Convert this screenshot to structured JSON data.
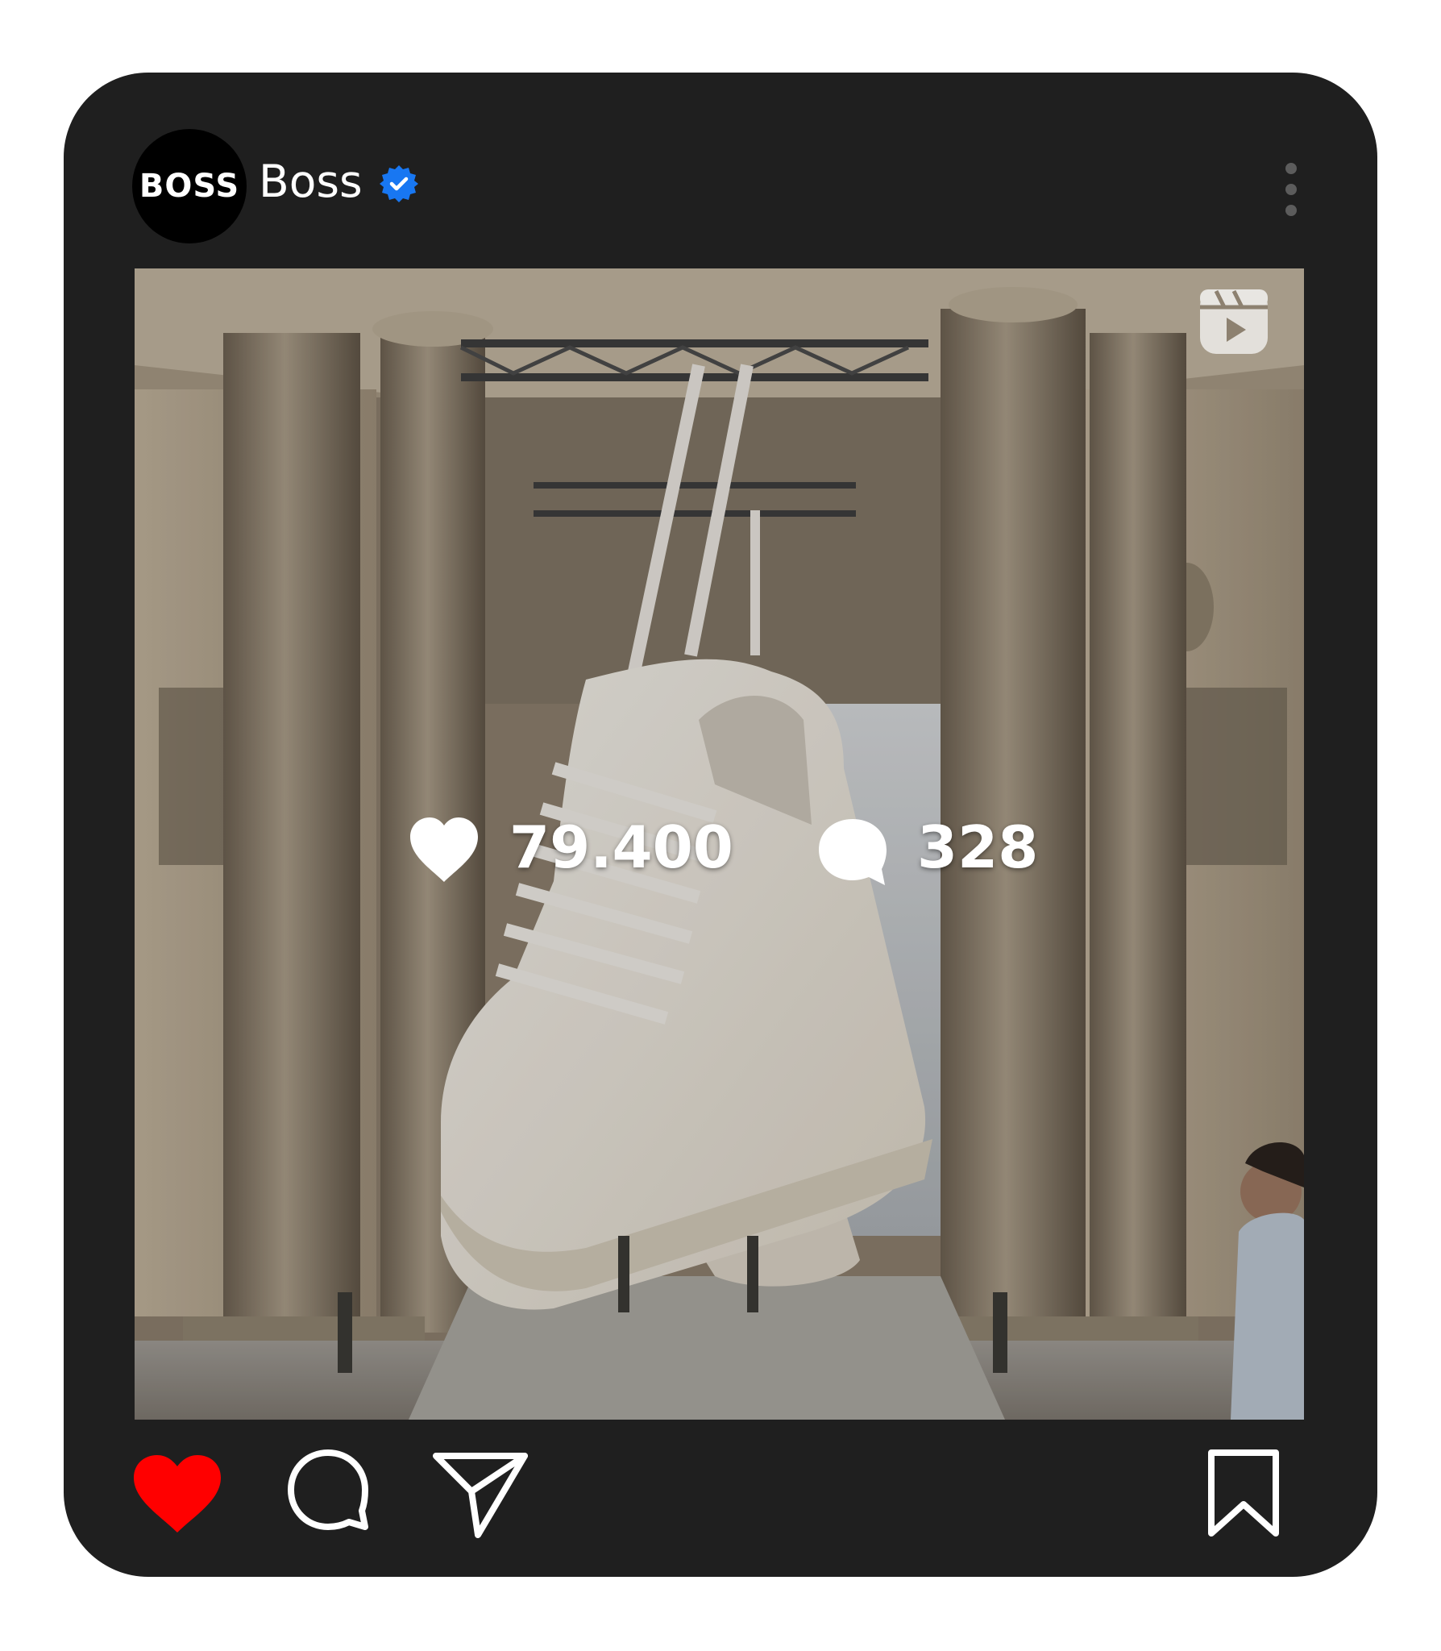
{
  "post": {
    "account": {
      "avatar_text": "BOSS",
      "username": "Boss",
      "verified": true
    },
    "media": {
      "type": "reel",
      "stats": {
        "likes": "79.400",
        "comments": "328"
      }
    },
    "actions": {
      "liked": true,
      "like_color": "#ff0000"
    }
  },
  "colors": {
    "card_background": "#1f1f1f",
    "verified_badge": "#1877f2",
    "icon_stroke": "#ffffff"
  },
  "icons": [
    "verified-badge-icon",
    "more-options-icon",
    "reels-icon",
    "heart-icon",
    "comment-icon",
    "share-icon",
    "bookmark-icon"
  ]
}
